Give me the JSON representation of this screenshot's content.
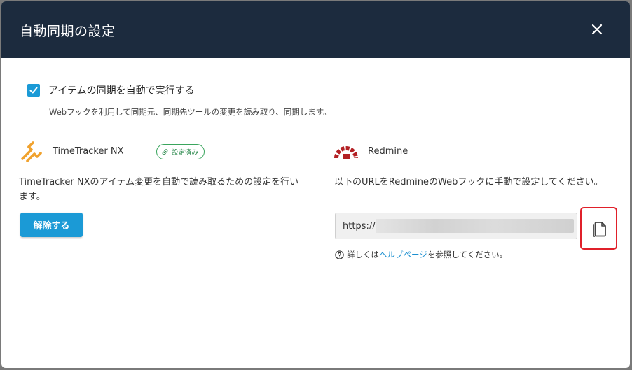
{
  "dialog": {
    "title": "自動同期の設定",
    "close_icon": "close-icon"
  },
  "auto_sync": {
    "checked": true,
    "label": "アイテムの同期を自動で実行する",
    "description": "Webフックを利用して同期元、同期先ツールの変更を読み取り、同期します。"
  },
  "source": {
    "name": "TimeTracker NX",
    "badge": "設定済み",
    "description": "TimeTracker NXのアイテム変更を自動で読み取るための設定を行います。",
    "release_button": "解除する"
  },
  "target": {
    "name": "Redmine",
    "description": "以下のURLをRedmineのWebフックに手動で設定してください。",
    "url_prefix": "https://",
    "copy_icon": "copy-icon",
    "help_prefix": "詳しくは",
    "help_link": "ヘルプページ",
    "help_suffix": "を参照してください。"
  },
  "colors": {
    "header_bg": "#1c2b3e",
    "accent": "#1b9ad6",
    "badge_green": "#3aa55d",
    "highlight_red": "#e0202a",
    "redmine_red": "#b32024",
    "timetracker_orange": "#f0a22e"
  }
}
